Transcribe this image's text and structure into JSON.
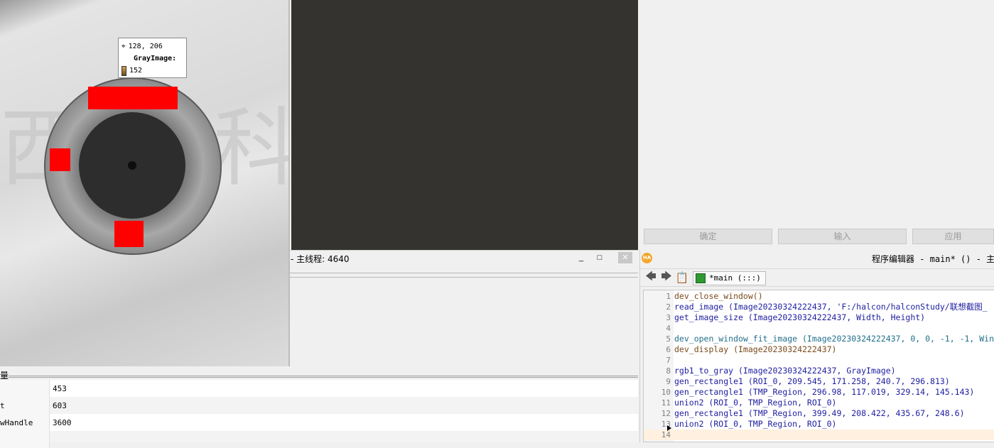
{
  "tooltip": {
    "coords": "128, 206",
    "image_name": "GrayImage:",
    "gray_value": "152"
  },
  "right_buttons": [
    "确定",
    "输入",
    "应用"
  ],
  "thread_window": {
    "title": "- 主线程: 4640",
    "minimize": "_",
    "maximize": "□",
    "close": "✕"
  },
  "variables": {
    "header": "量",
    "rows": [
      {
        "name": "",
        "value": "453"
      },
      {
        "name": "t",
        "value": "603"
      },
      {
        "name": "wHandle",
        "value": "3600"
      }
    ]
  },
  "editor": {
    "logo": "HA",
    "title": "程序编辑器 - main* () - 主线程",
    "procedure_tab": "*main (:::)",
    "lines": [
      {
        "n": "1",
        "text": "dev_close_window()",
        "cls": "op-brown"
      },
      {
        "n": "2",
        "text": "read_image (Image20230324222437, 'F:/halcon/halconStudy/联想截图_",
        "cls": "op-navy"
      },
      {
        "n": "3",
        "text": "get_image_size (Image20230324222437, Width, Height)",
        "cls": "op-navy"
      },
      {
        "n": "4",
        "text": "",
        "cls": ""
      },
      {
        "n": "5",
        "text": "dev_open_window_fit_image (Image20230324222437, 0, 0, -1, -1, Win",
        "cls": "op-teal"
      },
      {
        "n": "6",
        "text": "dev_display (Image20230324222437)",
        "cls": "op-brown"
      },
      {
        "n": "7",
        "text": "",
        "cls": ""
      },
      {
        "n": "8",
        "text": "rgb1_to_gray (Image20230324222437, GrayImage)",
        "cls": "op-navy"
      },
      {
        "n": "9",
        "text": "gen_rectangle1 (ROI_0, 209.545, 171.258, 240.7, 296.813)",
        "cls": "op-navy"
      },
      {
        "n": "10",
        "text": "gen_rectangle1 (TMP_Region, 296.98, 117.019, 329.14, 145.143)",
        "cls": "op-navy"
      },
      {
        "n": "11",
        "text": "union2 (ROI_0, TMP_Region, ROI_0)",
        "cls": "op-navy"
      },
      {
        "n": "12",
        "text": "gen_rectangle1 (TMP_Region, 399.49, 208.422, 435.67, 248.6)",
        "cls": "op-navy"
      },
      {
        "n": "13",
        "text": "union2 (ROI_0, TMP_Region, ROI_0)",
        "cls": "op-navy"
      },
      {
        "n": "14",
        "text": "",
        "cls": ""
      }
    ]
  }
}
